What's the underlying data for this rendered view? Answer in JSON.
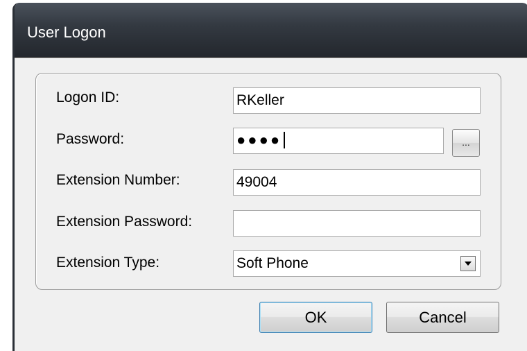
{
  "window": {
    "title": "User Logon"
  },
  "form": {
    "logon_id": {
      "label": "Logon ID:",
      "value": "RKeller"
    },
    "password": {
      "label": "Password:",
      "masked_value": "●●●●",
      "browse_label": "..."
    },
    "extension_number": {
      "label": "Extension Number:",
      "value": "49004"
    },
    "extension_password": {
      "label": "Extension Password:",
      "value": ""
    },
    "extension_type": {
      "label": "Extension Type:",
      "selected": "Soft Phone"
    }
  },
  "buttons": {
    "ok": "OK",
    "cancel": "Cancel"
  },
  "colors": {
    "titlebar": "#343a42",
    "title_text": "#ffffff",
    "dialog_bg": "#f0f0f0"
  }
}
